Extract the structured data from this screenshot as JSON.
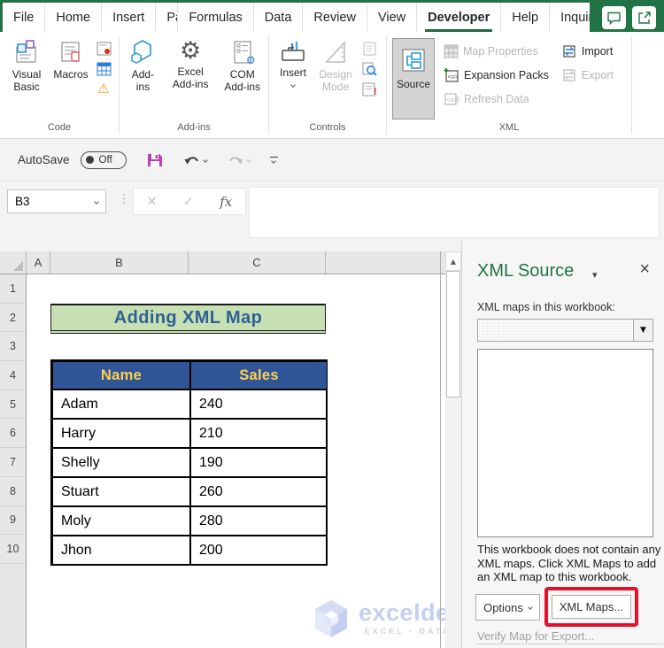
{
  "tab_bar": {
    "tabs": [
      "File",
      "Home",
      "Insert",
      "Page Layout",
      "Formulas",
      "Data",
      "Review",
      "View",
      "Developer",
      "Help",
      "Inquire"
    ],
    "active_tab": "Developer"
  },
  "ribbon": {
    "code_group": {
      "label": "Code",
      "visual_basic": "Visual Basic",
      "macros": "Macros"
    },
    "addins_group": {
      "label": "Add-ins",
      "add_ins": "Add-ins",
      "excel_add_ins": "Excel Add-ins",
      "com_add_ins": "COM Add-ins"
    },
    "controls_group": {
      "label": "Controls",
      "insert": "Insert",
      "design_mode": "Design Mode"
    },
    "xml_group": {
      "label": "XML",
      "source": "Source",
      "map_properties": "Map Properties",
      "expansion_packs": "Expansion Packs",
      "refresh_data": "Refresh Data",
      "import": "Import",
      "export": "Export"
    }
  },
  "quick_access": {
    "autosave_label": "AutoSave",
    "autosave_state": "Off"
  },
  "formula_bar": {
    "name_box_value": "B3",
    "fx_label": "fx"
  },
  "sheet": {
    "column_headers": [
      "A",
      "B",
      "C"
    ],
    "row_headers": [
      "1",
      "2",
      "3",
      "4",
      "5",
      "6",
      "7",
      "8",
      "9",
      "10"
    ],
    "title_cell": "Adding XML Map",
    "table": {
      "headers": [
        "Name",
        "Sales"
      ],
      "rows": [
        [
          "Adam",
          "240"
        ],
        [
          "Harry",
          "210"
        ],
        [
          "Shelly",
          "190"
        ],
        [
          "Stuart",
          "260"
        ],
        [
          "Moly",
          "280"
        ],
        [
          "Jhon",
          "200"
        ]
      ]
    }
  },
  "watermark": {
    "brand": "exceldemy",
    "tagline": "EXCEL - DATA - BI"
  },
  "xml_pane": {
    "title": "XML Source",
    "maps_label": "XML maps in this workbook:",
    "empty_message": "This workbook does not contain any XML maps. Click XML Maps to add an XML map to this workbook.",
    "options_button": "Options",
    "xml_maps_button": "XML Maps...",
    "verify_link": "Verify Map for Export..."
  },
  "icons": {
    "warning": "⚠",
    "gear": "⚙",
    "scroll_up": "▲",
    "dropdown": "▼",
    "caret": "▾",
    "close": "×",
    "cancel": "✕",
    "check": "✓",
    "dots": "⋮"
  },
  "colors": {
    "excel_green": "#217346",
    "icon_blue": "#2B7CD3",
    "table_header_bg": "#2F5597",
    "table_header_text": "#FFD24F",
    "title_bg": "#C6E0B4",
    "title_text": "#2E6191",
    "annotation_red": "#E4112B",
    "watermark_blue": "#C5D0F0"
  }
}
